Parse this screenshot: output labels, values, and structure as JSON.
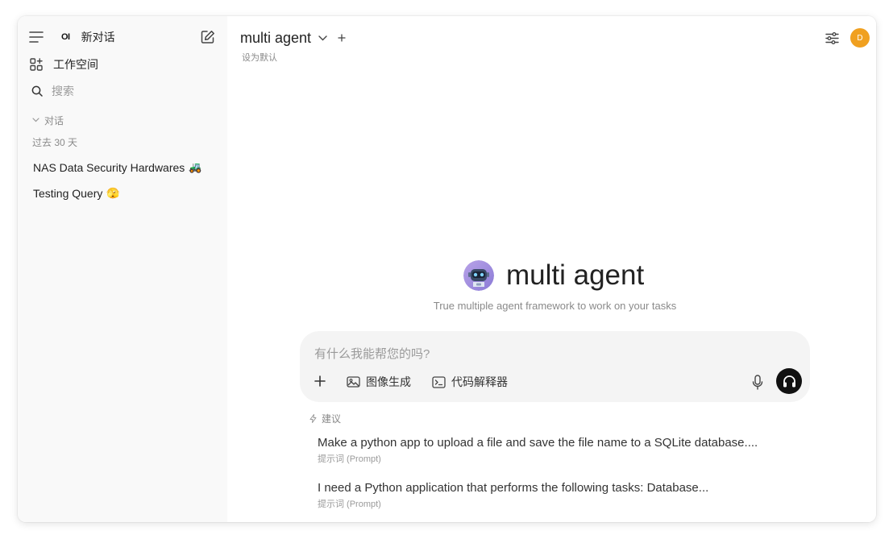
{
  "sidebar": {
    "brand_logo": "OI",
    "new_chat_label": "新对话",
    "workspace_label": "工作空间",
    "search_placeholder": "搜索",
    "section_label": "对话",
    "group_label": "过去 30 天",
    "chats": [
      {
        "title": "NAS Data Security Hardwares",
        "emoji": "🚜"
      },
      {
        "title": "Testing Query",
        "emoji": "🫣"
      }
    ]
  },
  "header": {
    "model_name": "multi agent",
    "set_default": "设为默认",
    "avatar_initial": "D",
    "avatar_color": "#f0a020"
  },
  "hero": {
    "title": "multi agent",
    "subtitle": "True multiple agent framework to work on your tasks"
  },
  "composer": {
    "placeholder": "有什么我能帮您的吗?",
    "image_gen_label": "图像生成",
    "code_interpreter_label": "代码解释器"
  },
  "suggestions": {
    "header": "建议",
    "items": [
      {
        "title": "Make a python app to upload a file and save the file name to a SQLite database....",
        "subtitle": "提示词 (Prompt)"
      },
      {
        "title": "I need a Python application that performs the following tasks: Database...",
        "subtitle": "提示词 (Prompt)"
      }
    ]
  }
}
